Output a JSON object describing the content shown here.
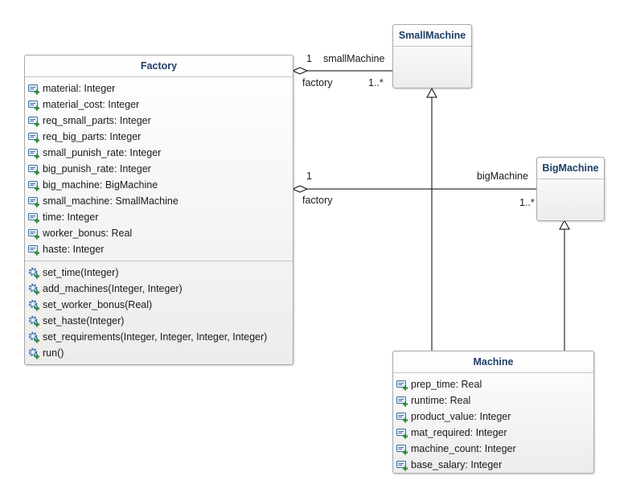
{
  "diagram": {
    "classes": {
      "factory": {
        "name": "Factory",
        "attributes": [
          "material: Integer",
          "material_cost: Integer",
          "req_small_parts: Integer",
          "req_big_parts: Integer",
          "small_punish_rate: Integer",
          "big_punish_rate: Integer",
          "big_machine: BigMachine",
          "small_machine: SmallMachine",
          "time: Integer",
          "worker_bonus: Real",
          "haste: Integer"
        ],
        "operations": [
          "set_time(Integer)",
          "add_machines(Integer, Integer)",
          "set_worker_bonus(Real)",
          "set_haste(Integer)",
          "set_requirements(Integer, Integer, Integer, Integer)",
          "run()"
        ]
      },
      "small_machine": {
        "name": "SmallMachine",
        "attributes": [],
        "operations": []
      },
      "big_machine": {
        "name": "BigMachine",
        "attributes": [],
        "operations": []
      },
      "machine": {
        "name": "Machine",
        "attributes": [
          "prep_time: Real",
          "runtime: Real",
          "product_value: Integer",
          "mat_required: Integer",
          "machine_count: Integer",
          "base_salary: Integer"
        ],
        "operations": []
      }
    },
    "associations": {
      "factory_small": {
        "source_mult": "1",
        "source_role": "factory",
        "target_role": "smallMachine",
        "target_mult": "1..*"
      },
      "factory_big": {
        "source_mult": "1",
        "source_role": "factory",
        "target_role": "bigMachine",
        "target_mult": "1..*"
      }
    },
    "icons": {
      "attribute": "attribute-icon",
      "operation": "operation-icon"
    },
    "colors": {
      "class_name": "#1e3f66",
      "border": "#a8a8a8",
      "line": "#000000",
      "attr_icon_fill": "#e4edf6",
      "attr_icon_stroke": "#3d6e9e",
      "plus": "#2e8b3a",
      "gear": "#3a6ea5"
    }
  }
}
